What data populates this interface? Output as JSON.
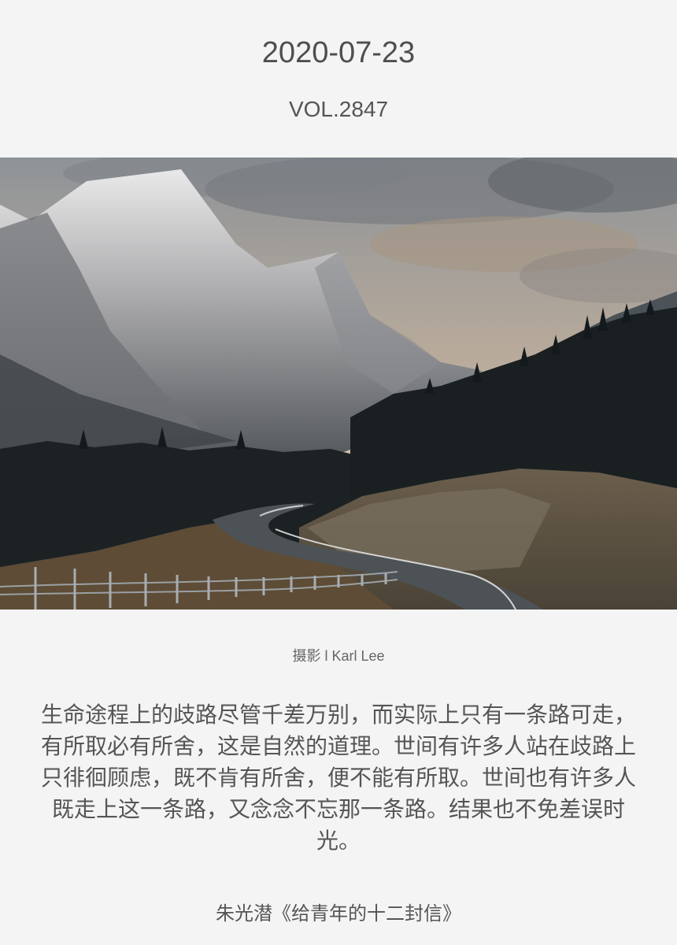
{
  "header": {
    "date": "2020-07-23",
    "volume": "VOL.2847"
  },
  "photo": {
    "credit": "摄影 l Karl Lee"
  },
  "quote": {
    "text": "生命途程上的歧路尽管千差万别，而实际上只有一条路可走，有所取必有所舍，这是自然的道理。世间有许多人站在歧路上只徘徊顾虑，既不肯有所舍，便不能有所取。世间也有许多人既走上这一条路，又念念不忘那一条路。结果也不免差误时光。",
    "source": "朱光潜《给青年的十二封信》"
  }
}
